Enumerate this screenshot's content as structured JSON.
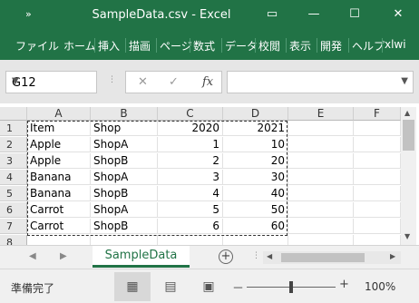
{
  "window": {
    "qat_symbol": "»",
    "title": "SampleData.csv  -  Excel",
    "controls": {
      "ribbon_display": "▭",
      "minimize": "—",
      "maximize": "☐",
      "close": "✕"
    }
  },
  "ribbon": {
    "tabs": [
      "ファイル",
      "ホーム",
      "挿入",
      "描画",
      "ページ",
      "数式",
      "データ",
      "校閲",
      "表示",
      "開発",
      "ヘルプ",
      "xlwi"
    ]
  },
  "formula_bar": {
    "name_box": "G12",
    "cancel_symbol": "✕",
    "enter_symbol": "✓",
    "fx_symbol": "fx",
    "formula": ""
  },
  "sheet": {
    "columns": [
      "A",
      "B",
      "C",
      "D",
      "E",
      "F"
    ],
    "rows": [
      "1",
      "2",
      "3",
      "4",
      "5",
      "6",
      "7",
      "8"
    ],
    "cells": [
      [
        "Item",
        "Shop",
        "2020",
        "2021"
      ],
      [
        "Apple",
        "ShopA",
        "1",
        "10"
      ],
      [
        "Apple",
        "ShopB",
        "2",
        "20"
      ],
      [
        "Banana",
        "ShopA",
        "3",
        "30"
      ],
      [
        "Banana",
        "ShopB",
        "4",
        "40"
      ],
      [
        "Carrot",
        "ShopA",
        "5",
        "50"
      ],
      [
        "Carrot",
        "ShopB",
        "6",
        "60"
      ],
      [
        "",
        "",
        "",
        ""
      ]
    ]
  },
  "sheet_tabs": {
    "active": "SampleData",
    "add_symbol": "+",
    "prev_symbol": "◀",
    "next_symbol": "▶"
  },
  "status_bar": {
    "status": "準備完了",
    "views": [
      "▦",
      "▤",
      "▣"
    ],
    "zoom_minus": "－",
    "zoom_plus": "+",
    "zoom_level": "100%"
  }
}
